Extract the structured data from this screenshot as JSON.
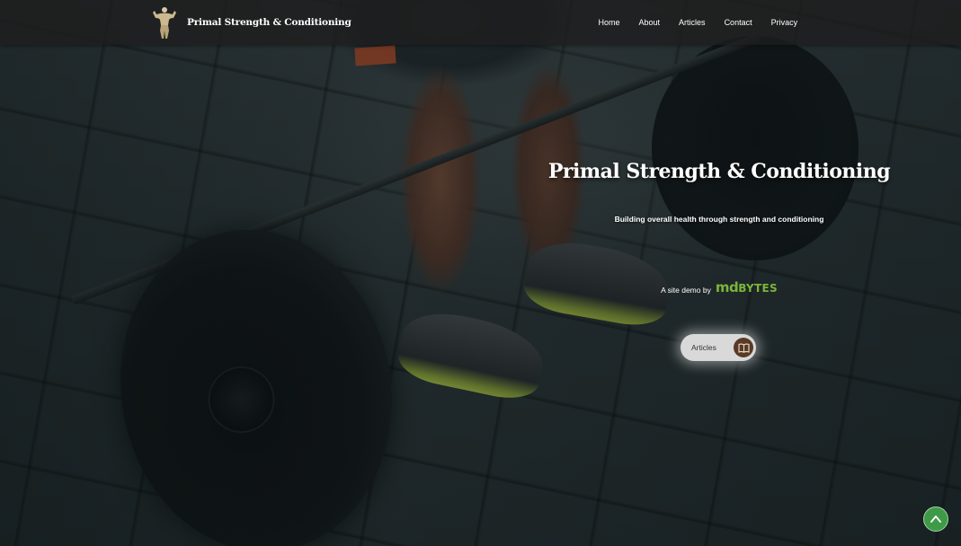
{
  "site": {
    "brand_name": "Primal Strength & Conditioning",
    "logo_icon": "bodybuilder-logo-icon"
  },
  "nav": {
    "items": [
      {
        "label": "Home"
      },
      {
        "label": "About"
      },
      {
        "label": "Articles"
      },
      {
        "label": "Contact"
      },
      {
        "label": "Privacy"
      }
    ]
  },
  "hero": {
    "title": "Primal Strength & Conditioning",
    "subtitle": "Building overall health through strength and conditioning",
    "demo_text": "A site demo by",
    "demo_brand_md": "md",
    "demo_brand_bytes": "BYTES",
    "cta_label": "Articles",
    "cta_icon": "book-icon"
  },
  "colors": {
    "accent_green": "#7bb53a",
    "cta_icon_bg": "#5a3a24",
    "back_to_top": "#3f9a48"
  },
  "back_to_top_icon": "chevron-up-icon"
}
